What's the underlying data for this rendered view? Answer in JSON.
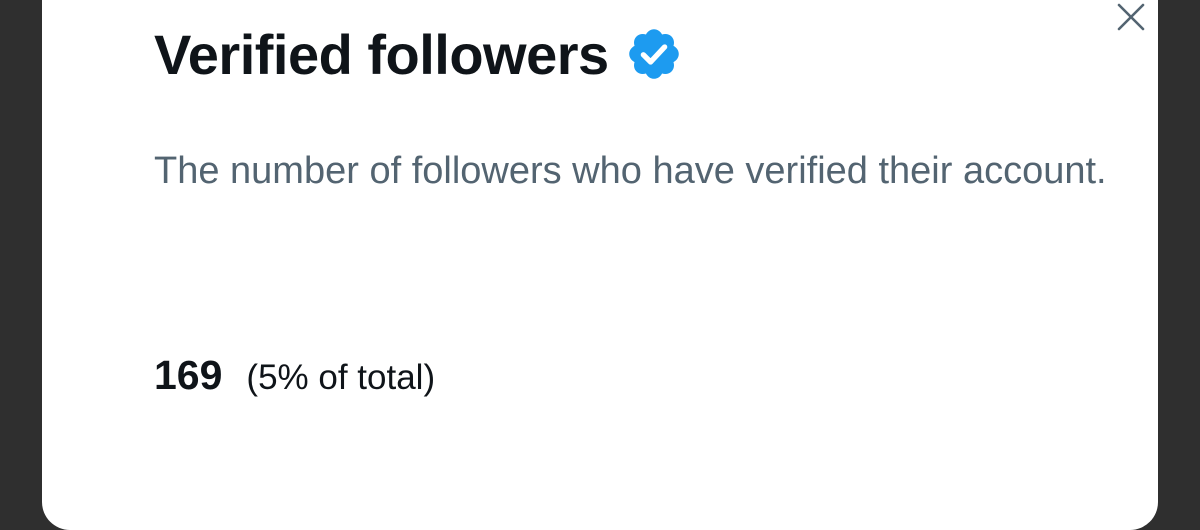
{
  "dialog": {
    "title": "Verified followers",
    "description": "The number of followers who have verified their account.",
    "count": "169",
    "percent_text": "(5% of total)",
    "close_icon": "close-icon",
    "badge_icon": "verified-badge-icon",
    "colors": {
      "title": "#0f1419",
      "description": "#536471",
      "badge": "#1d9bf0",
      "close": "#536471"
    }
  }
}
